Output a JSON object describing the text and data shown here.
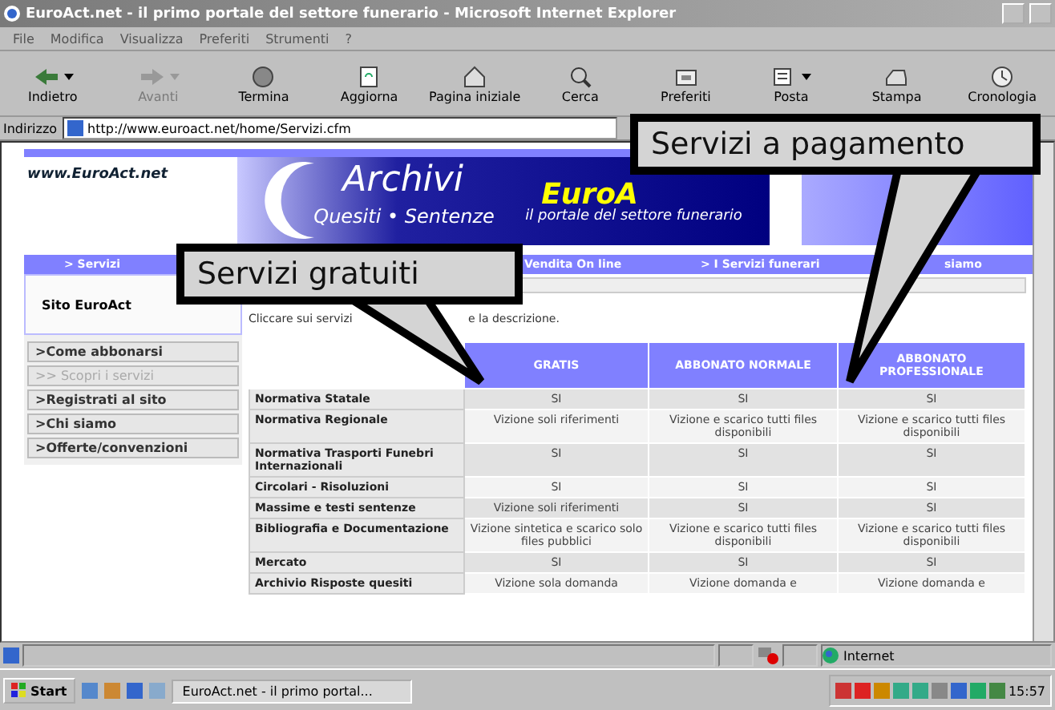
{
  "window": {
    "title": "EuroAct.net - il primo portale del settore funerario - Microsoft Internet Explorer"
  },
  "menu": [
    "File",
    "Modifica",
    "Visualizza",
    "Preferiti",
    "Strumenti",
    "?"
  ],
  "toolbar": [
    {
      "label": "Indietro",
      "kind": "back",
      "disabled": false,
      "dropdown": true
    },
    {
      "label": "Avanti",
      "kind": "forward",
      "disabled": true,
      "dropdown": true
    },
    {
      "label": "Termina",
      "kind": "stop",
      "disabled": false,
      "dropdown": false
    },
    {
      "label": "Aggiorna",
      "kind": "refresh",
      "disabled": false,
      "dropdown": false
    },
    {
      "label": "Pagina iniziale",
      "kind": "home",
      "disabled": false,
      "dropdown": false
    },
    {
      "label": "Cerca",
      "kind": "search",
      "disabled": false,
      "dropdown": false
    },
    {
      "label": "Preferiti",
      "kind": "favorites",
      "disabled": false,
      "dropdown": false
    },
    {
      "label": "Posta",
      "kind": "mail",
      "disabled": false,
      "dropdown": true
    },
    {
      "label": "Stampa",
      "kind": "print",
      "disabled": false,
      "dropdown": false
    },
    {
      "label": "Cronologia",
      "kind": "history",
      "disabled": false,
      "dropdown": false
    }
  ],
  "address": {
    "label": "Indirizzo",
    "value": "http://www.euroact.net/home/Servizi.cfm"
  },
  "page": {
    "logo": "www.EuroAct.net",
    "banner": {
      "title": "Archivi",
      "subtitle": "Quesiti • Sentenze",
      "brand": "EuroA",
      "tagline": "il portale del settore funerario"
    },
    "nav": [
      "> Servizi",
      "Vendita On line",
      "> I Servizi funerari",
      "siamo"
    ],
    "sidebar": {
      "title": "Sito EuroAct",
      "items": [
        {
          "label": ">Come abbonarsi",
          "selected": false
        },
        {
          "label": ">> Scopri i servizi",
          "selected": true
        },
        {
          "label": ">Registrati al sito",
          "selected": false
        },
        {
          "label": ">Chi siamo",
          "selected": false
        },
        {
          "label": ">Offerte/convenzioni",
          "selected": false
        }
      ]
    },
    "intro": [
      "Cliccare sui servizi",
      "e la descrizione."
    ],
    "table": {
      "columns": [
        "GRATIS",
        "ABBONATO NORMALE",
        "ABBONATO PROFESSIONALE"
      ],
      "rows": [
        {
          "service": "Normativa Statale",
          "cells": [
            "SI",
            "SI",
            "SI"
          ]
        },
        {
          "service": "Normativa Regionale",
          "cells": [
            "Vizione soli riferimenti",
            "Vizione e scarico tutti files disponibili",
            "Vizione e scarico tutti files disponibili"
          ]
        },
        {
          "service": "Normativa Trasporti Funebri Internazionali",
          "cells": [
            "SI",
            "SI",
            "SI"
          ]
        },
        {
          "service": "Circolari - Risoluzioni",
          "cells": [
            "SI",
            "SI",
            "SI"
          ]
        },
        {
          "service": "Massime e testi sentenze",
          "cells": [
            "Vizione soli riferimenti",
            "SI",
            "SI"
          ]
        },
        {
          "service": "Bibliografia e Documentazione",
          "cells": [
            "Vizione sintetica e scarico solo files pubblici",
            "Vizione e scarico tutti files disponibili",
            "Vizione e scarico tutti files disponibili"
          ]
        },
        {
          "service": "Mercato",
          "cells": [
            "SI",
            "SI",
            "SI"
          ]
        },
        {
          "service": "Archivio Risposte quesiti",
          "cells": [
            "Vizione sola domanda",
            "Vizione domanda e",
            "Vizione domanda e"
          ]
        }
      ]
    }
  },
  "callouts": [
    {
      "text": "Servizi gratuiti"
    },
    {
      "text": "Servizi a pagamento"
    }
  ],
  "status_bar": {
    "zone": "Internet"
  },
  "taskbar": {
    "start": "Start",
    "tasks": [
      "EuroAct.net - il primo portal..."
    ],
    "clock": "15:57"
  }
}
